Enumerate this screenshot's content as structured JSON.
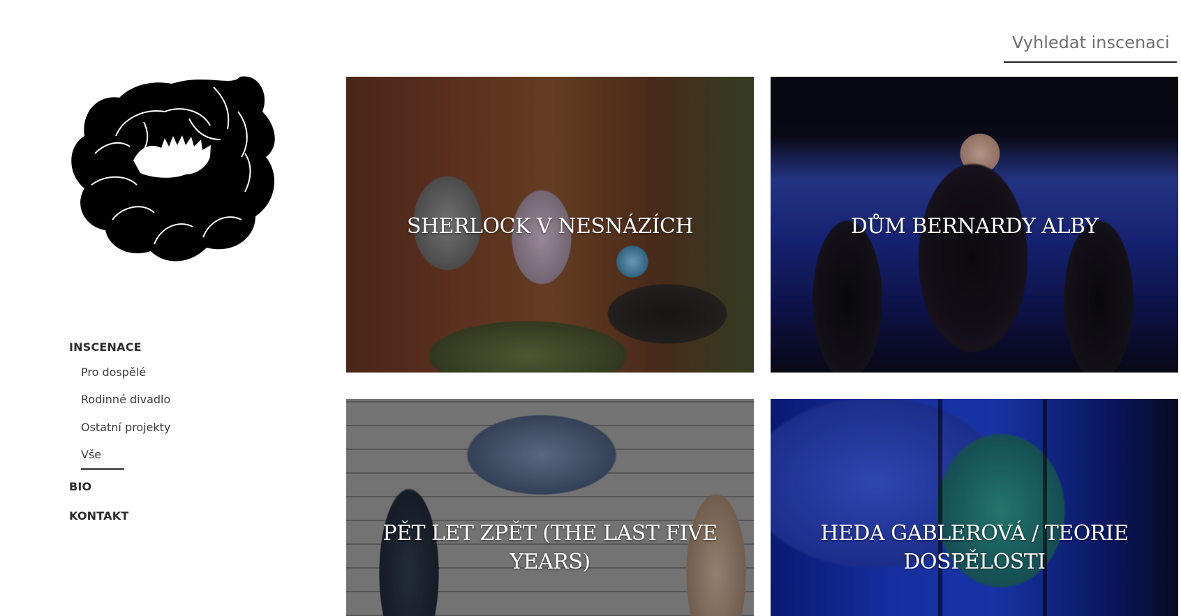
{
  "search": {
    "placeholder": "Vyhledat inscenaci"
  },
  "logo": {
    "icon": "peony-flower-logo",
    "color": "#000000"
  },
  "nav": {
    "main_items": [
      {
        "label": "INSCENACE"
      },
      {
        "label": "BIO"
      },
      {
        "label": "KONTAKT"
      }
    ],
    "sub_items": [
      {
        "label": "Pro dospělé"
      },
      {
        "label": "Rodinné divadlo"
      },
      {
        "label": "Ostatní projekty"
      },
      {
        "label": "Vše",
        "active": true
      }
    ]
  },
  "productions": [
    {
      "title": "SHERLOCK V NESNÁZÍCH"
    },
    {
      "title": "DŮM BERNARDY ALBY"
    },
    {
      "title": "PĚT LET ZPĚT (THE LAST FIVE YEARS)"
    },
    {
      "title": "HEDA GABLEROVÁ / TEORIE DOSPĚLOSTI"
    }
  ]
}
